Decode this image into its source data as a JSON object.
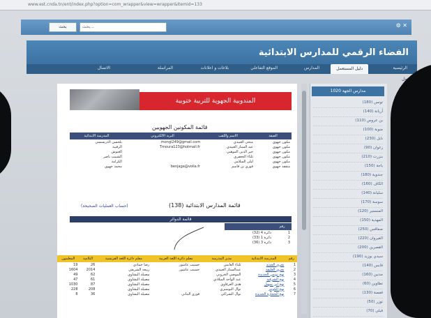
{
  "browser": {
    "url": "www.est.cnda.tn/ent/index.php?option=com_wrapper&view=wrapper&Itemid=133"
  },
  "toolbar": {
    "search_button": "بحث",
    "search_placeholder": "بحث..."
  },
  "header": {
    "title": "الفضاء الرقمي للمدارس الابتدائية"
  },
  "nav": {
    "items": [
      "الرئيسية",
      "دليل المستعمل",
      "المدارس",
      "الموقع التفاعلي",
      "بلاغات و اعلانات",
      "المراسلة",
      "الاتصال"
    ],
    "active_index": 1
  },
  "mini_label": "دخول",
  "sidebar": {
    "head": "مدارس الجهة  1020",
    "items": [
      "تونس (180)",
      "أريانة (140)",
      "بن عروس (110)",
      "منوبة (100)",
      "نابل (230)",
      "زغوان (90)",
      "بنزرت (210)",
      "باجة (150)",
      "جندوبة (180)",
      "الكاف (160)",
      "سليانة (140)",
      "سوسة (170)",
      "المنستير (120)",
      "المهدية (150)",
      "صفاقس (250)",
      "القيروان (220)",
      "القصرين (200)",
      "سيدي بوزيد (190)",
      "قابس (140)",
      "مدنين (160)",
      "تطاوين (60)",
      "قفصة (130)",
      "توزر (50)",
      "قبلي (70)"
    ]
  },
  "doc": {
    "banner_text": "المندوبية الجهوية للتربية ختوبية",
    "trainers_title": "قائمة المكونين الجهويين",
    "trainers_headers": [
      "الصفة",
      "الاسم واللقب",
      "البريد الالكتروني",
      "المدرسة الابتدائية"
    ],
    "trainers_rows": [
      [
        "مكون جهوي",
        "منجي العبيدي",
        "mongi249@gmail.com",
        "بلحسن الدريسسي"
      ],
      [
        "مكون جهوي",
        "عبد الستار العبيدي",
        "Tmoura123@hotmail.fr",
        "الرقيبة"
      ],
      [
        "مكون جهوي",
        "خير الدين الموهبي",
        "",
        "العنوش"
      ],
      [
        "مكون جهوي",
        "ثلثاء الجعفري",
        "",
        "الشبيب ناصر"
      ],
      [
        "مكون جهوي",
        "ليلى السلامي",
        "",
        "الكرامة"
      ],
      [
        "متفقد جهوي",
        "فوزي بن قاسم",
        "benjaga@voila.fr",
        "محمد جهوي"
      ]
    ],
    "schools_title": "قائمة المدارس الابتدائية (138)",
    "schools_link": "(حساب العمليات الصحيحة)",
    "subbar": "قائمة الدوائر",
    "circles_header": "رقم",
    "circles": [
      {
        "no": "1",
        "name": "دائرة 4 (32)"
      },
      {
        "no": "2",
        "name": "دائرة 1 (33)"
      },
      {
        "no": "3",
        "name": "دائرة 3 (36)"
      }
    ],
    "schools_headers": [
      "رقم",
      "المدرسة الابتدائية",
      "مدير المدرسة",
      "معلم دائرة اللغة العربية",
      "معلم دائرة اللغة الفرنسية",
      "التلاميذ",
      "المعلمون"
    ],
    "schools_rows": [
      [
        "1",
        "بحري الجديد",
        "ثلثاء العابس",
        "حسيب عاشور",
        "رضا حمادي",
        "26",
        "19"
      ],
      [
        "2",
        "بحري العليقة",
        "عبدالستار العبيدي",
        "حسيب عاشور",
        "ربيعة الشريفي",
        "2014",
        "1604"
      ],
      [
        "3",
        "نهج تونس الجديدة",
        "الموصي الخروبي",
        "",
        "مصيلة البشاوي",
        "62",
        "49"
      ],
      [
        "4",
        "نهج الشرقية",
        "عبد الواحد الميلادي",
        "",
        "مصيلة البشاوي",
        "61",
        "47"
      ],
      [
        "5",
        "نهج ابن سهيل",
        "هدى العرفاوي",
        "",
        "مصيلة البشاوي",
        "87",
        "1030"
      ],
      [
        "6",
        "نهج الكونتر",
        "نوال البوسيري",
        "",
        "مصيلة البشاوي",
        "208",
        "228"
      ],
      [
        "7",
        "نهج الحجارة الجديدة",
        "نوال الشراكي",
        "فوزي البناني",
        "مصيلة البشاوي",
        "36",
        "8"
      ]
    ]
  }
}
